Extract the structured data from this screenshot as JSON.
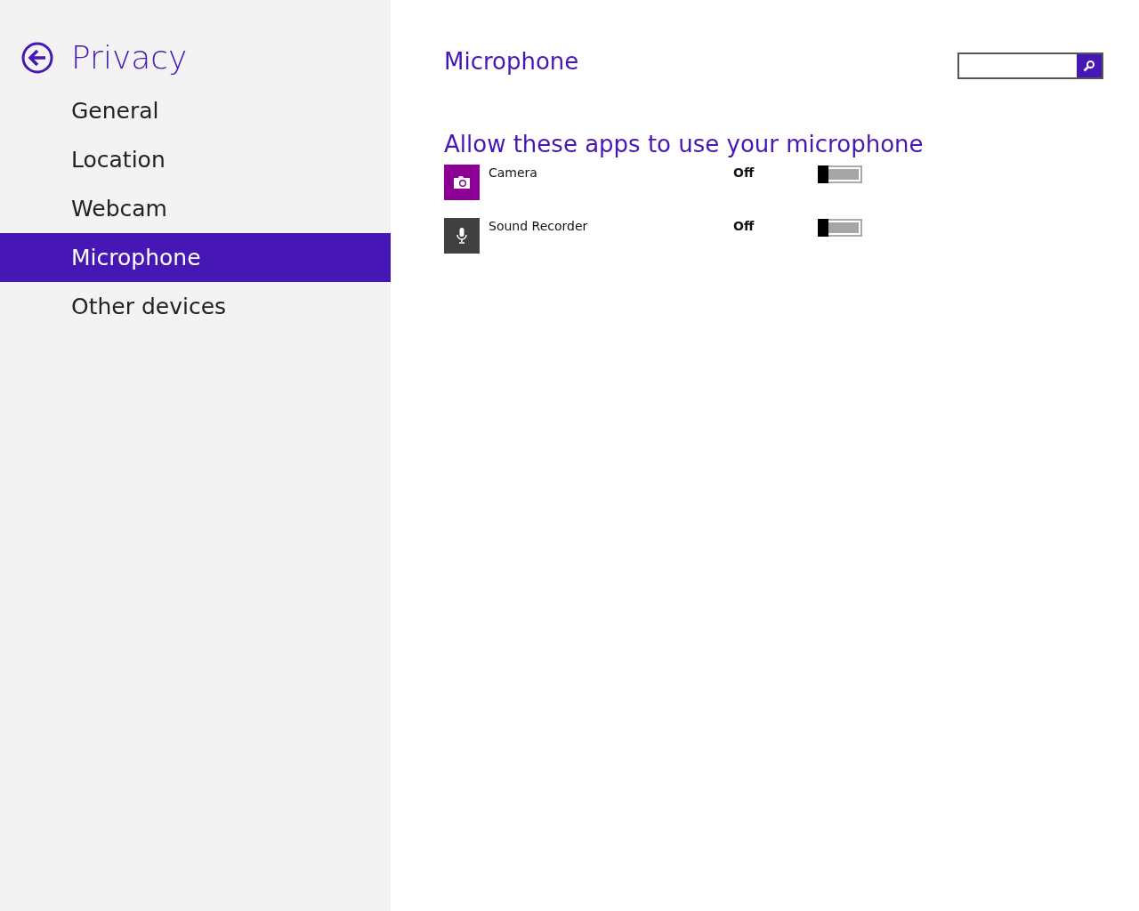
{
  "sidebar": {
    "title": "Privacy",
    "items": [
      {
        "label": "General",
        "selected": false
      },
      {
        "label": "Location",
        "selected": false
      },
      {
        "label": "Webcam",
        "selected": false
      },
      {
        "label": "Microphone",
        "selected": true
      },
      {
        "label": "Other devices",
        "selected": false
      }
    ]
  },
  "page": {
    "title": "Microphone",
    "section_title": "Allow these apps to use your microphone",
    "apps": [
      {
        "name": "Camera",
        "kind": "camera",
        "color": "#8c0095",
        "state_label": "Off",
        "on": false
      },
      {
        "name": "Sound Recorder",
        "kind": "recorder",
        "color": "#404040",
        "state_label": "Off",
        "on": false
      }
    ]
  }
}
